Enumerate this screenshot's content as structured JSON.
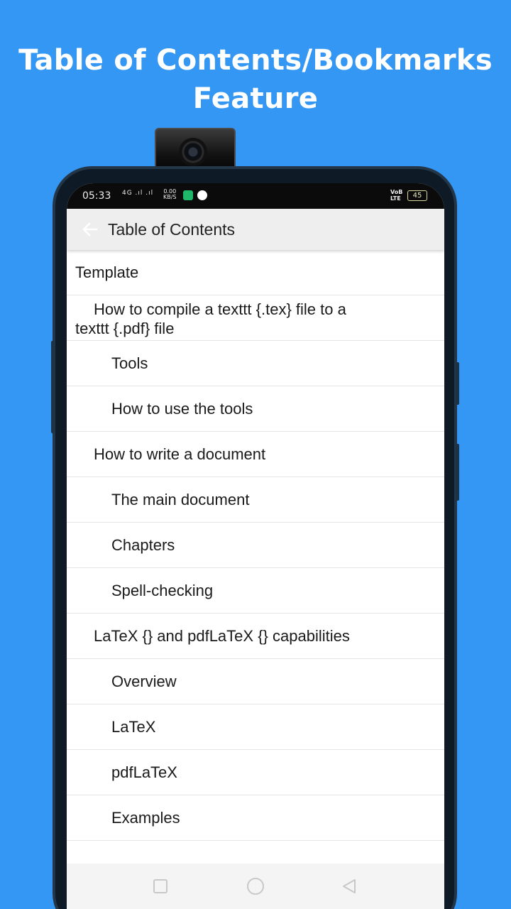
{
  "headline": {
    "line1": "Table of Contents/Bookmarks",
    "line2": "Feature"
  },
  "status_bar": {
    "time": "05:33",
    "signal": "4G .ıl .ıl",
    "net_speed_top": "0.00",
    "net_speed_bottom": "KB/S",
    "volte_top": "VoB",
    "volte_bottom": "LTE",
    "battery": "45"
  },
  "app_bar": {
    "back_icon": "arrow-left-icon",
    "title": "Table of Contents"
  },
  "toc": {
    "items": [
      {
        "label": "Template",
        "level": 0
      },
      {
        "label": "How to compile a texttt {.tex} file to a",
        "label2": "texttt {.pdf} file",
        "level": 1
      },
      {
        "label": "Tools",
        "level": 2
      },
      {
        "label": "How to use the tools",
        "level": 2
      },
      {
        "label": "How to write a document",
        "level": 1
      },
      {
        "label": "The main document",
        "level": 2
      },
      {
        "label": "Chapters",
        "level": 2
      },
      {
        "label": "Spell-checking",
        "level": 2
      },
      {
        "label": "LaTeX {} and pdfLaTeX {} capabilities",
        "level": 1
      },
      {
        "label": "Overview",
        "level": 2
      },
      {
        "label": "LaTeX",
        "level": 2
      },
      {
        "label": "pdfLaTeX",
        "level": 2
      },
      {
        "label": "Examples",
        "level": 2
      }
    ]
  },
  "nav_bar": {
    "recent_icon": "square-icon",
    "home_icon": "circle-icon",
    "back_icon": "triangle-back-icon"
  },
  "colors": {
    "background": "#3497f4",
    "app_bar": "#eeeeee",
    "status_bar": "#0b0b0b"
  }
}
